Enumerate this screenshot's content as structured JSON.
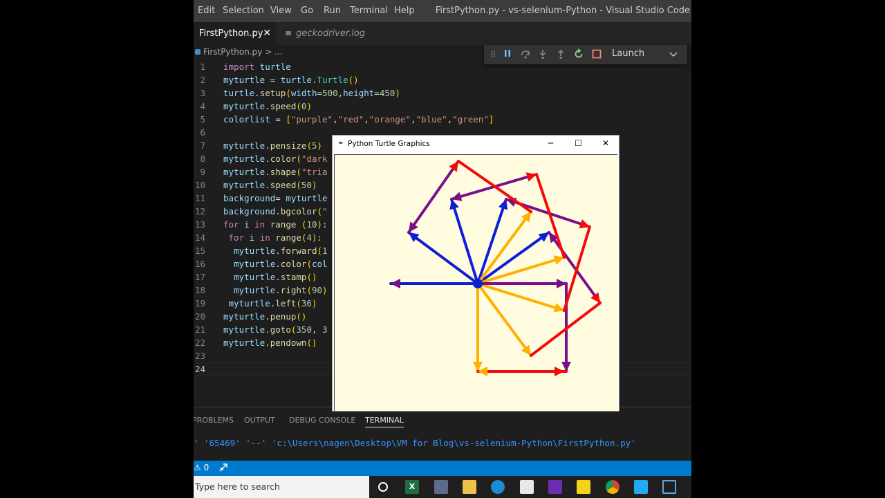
{
  "menu": {
    "items": [
      "Edit",
      "Selection",
      "View",
      "Go",
      "Run",
      "Terminal",
      "Help"
    ],
    "window_title": "FirstPython.py - vs-selenium-Python - Visual Studio Code"
  },
  "tabs": [
    {
      "label": "FirstPython.py",
      "close": "✕"
    },
    {
      "label": "geckodriver.log",
      "icon": "≡"
    }
  ],
  "debug": {
    "icons": [
      "grip-icon",
      "pause-icon",
      "step-over-icon",
      "step-into-icon",
      "step-out-icon",
      "restart-icon",
      "stop-icon"
    ],
    "config_label": "Launch"
  },
  "breadcrumb": {
    "file": "FirstPython.py",
    "sep": ">",
    "rest": "..."
  },
  "code": {
    "lines": [
      {
        "n": "1",
        "text": "import turtle"
      },
      {
        "n": "2",
        "text": "myturtle = turtle.Turtle()"
      },
      {
        "n": "3",
        "text": "turtle.setup(width=500,height=450)"
      },
      {
        "n": "4",
        "text": "myturtle.speed(0)"
      },
      {
        "n": "5",
        "text": "colorlist = [\"purple\",\"red\",\"orange\",\"blue\",\"green\"]"
      },
      {
        "n": "6",
        "text": ""
      },
      {
        "n": "7",
        "text": "myturtle.pensize(5)"
      },
      {
        "n": "8",
        "text": "myturtle.color(\"dark"
      },
      {
        "n": "9",
        "text": "myturtle.shape(\"tria"
      },
      {
        "n": "10",
        "text": "myturtle.speed(50)"
      },
      {
        "n": "11",
        "text": "background= myturtle"
      },
      {
        "n": "12",
        "text": "background.bgcolor(\""
      },
      {
        "n": "13",
        "text": "for i in range (10):"
      },
      {
        "n": "14",
        "text": " for i in range(4):"
      },
      {
        "n": "15",
        "text": "  myturtle.forward(1"
      },
      {
        "n": "16",
        "text": "  myturtle.color(col"
      },
      {
        "n": "17",
        "text": "  myturtle.stamp()"
      },
      {
        "n": "18",
        "text": "  myturtle.right(90)"
      },
      {
        "n": "19",
        "text": " myturtle.left(36)"
      },
      {
        "n": "20",
        "text": "myturtle.penup()"
      },
      {
        "n": "21",
        "text": "myturtle.goto(350, 3"
      },
      {
        "n": "22",
        "text": "myturtle.pendown()"
      },
      {
        "n": "23",
        "text": ""
      },
      {
        "n": "24",
        "text": ""
      }
    ]
  },
  "turtle_window": {
    "title": "Python Turtle Graphics",
    "controls": {
      "minimize": "─",
      "maximize": "☐",
      "close": "✕"
    },
    "background": "#fffce0",
    "colors": {
      "purple": "#7b0f8a",
      "red": "#f50a0a",
      "orange": "#ffb000",
      "blue": "#0d1ed6"
    }
  },
  "panel": {
    "tabs": [
      "PROBLEMS",
      "OUTPUT",
      "DEBUG CONSOLE",
      "TERMINAL"
    ],
    "terminal_text": "' '65469' '--' 'c:\\Users\\nagen\\Desktop\\VM for Blog\\vs-selenium-Python\\FirstPython.py'"
  },
  "status": {
    "warnings": "⚠ 0"
  },
  "taskbar": {
    "search_placeholder": "Type here to search",
    "icons": [
      "cortana-icon",
      "excel-icon",
      "snip-icon",
      "file-explorer-icon",
      "edge-icon",
      "notepad-icon",
      "visual-studio-icon",
      "sticky-notes-icon",
      "chrome-icon",
      "vscode-icon",
      "window-icon"
    ]
  }
}
